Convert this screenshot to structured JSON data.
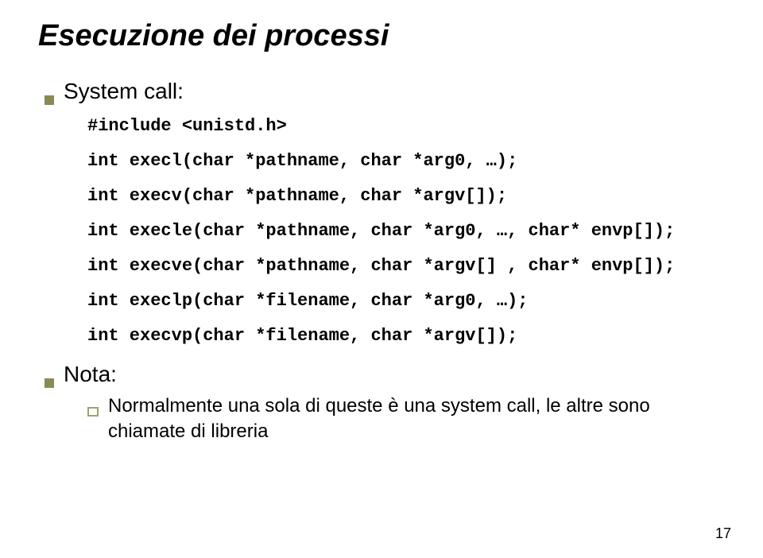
{
  "title": "Esecuzione dei processi",
  "sections": [
    {
      "heading": "System call:",
      "code_lines": [
        "#include <unistd.h>",
        "int execl(char *pathname, char *arg0, …);",
        "int execv(char *pathname, char *argv[]);",
        "int execle(char *pathname, char *arg0, …, char* envp[]);",
        "int execve(char *pathname, char *argv[] , char* envp[]);",
        "int execlp(char *filename, char *arg0, …);",
        "int execvp(char *filename, char *argv[]);"
      ]
    },
    {
      "heading": "Nota:",
      "sub_item": "Normalmente una sola di queste è una system call, le altre sono chiamate di libreria"
    }
  ],
  "page_number": "17"
}
